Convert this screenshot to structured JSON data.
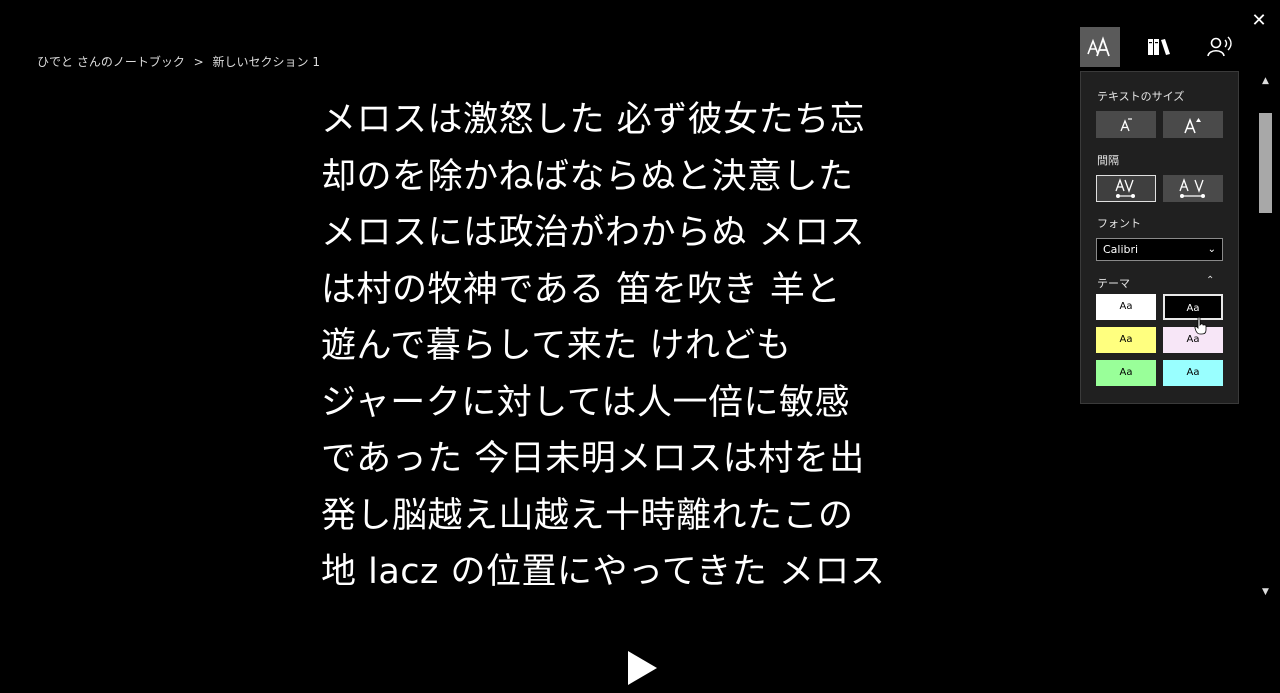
{
  "window": {
    "close_label": "✕"
  },
  "breadcrumb": {
    "notebook": "ひでと さんのノートブック",
    "separator": ">",
    "section": "新しいセクション 1"
  },
  "reader": {
    "lines": [
      "メロスは激怒した 必ず彼女たち忘",
      "却のを除かねばならぬと決意した",
      "メロスには政治がわからぬ メロス",
      "は村の牧神である 笛を吹き 羊と",
      "遊んで暮らして来た けれども",
      "ジャークに対しては人一倍に敏感",
      "であった 今日未明メロスは村を出",
      "発し脳越え山越え十時離れたこの",
      "地 lacz の位置にやってきた メロス"
    ]
  },
  "toolbar": {
    "icons": [
      "text-options-icon",
      "grammar-options-icon",
      "voice-options-icon"
    ]
  },
  "panel": {
    "text_size_label": "テキストのサイズ",
    "spacing_label": "間隔",
    "font_label": "フォント",
    "font_value": "Calibri",
    "theme_label": "テーマ",
    "theme_sample": "Aa",
    "themes": [
      {
        "bg": "#ffffff",
        "fg": "#000000",
        "selected": false
      },
      {
        "bg": "#000000",
        "fg": "#ffffff",
        "selected": true
      },
      {
        "bg": "#ffff7f",
        "fg": "#000000",
        "selected": false
      },
      {
        "bg": "#f7e6f7",
        "fg": "#000000",
        "selected": false
      },
      {
        "bg": "#99ff99",
        "fg": "#000000",
        "selected": false
      },
      {
        "bg": "#99ffff",
        "fg": "#000000",
        "selected": false
      }
    ]
  },
  "colors": {
    "background": "#000000",
    "panel": "#202020",
    "active_tab": "#5a5a5a"
  }
}
